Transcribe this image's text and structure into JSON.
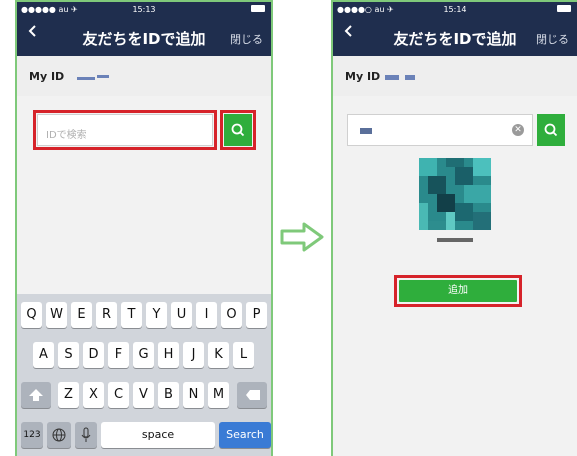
{
  "left": {
    "status": {
      "carrier": "●●●●● au ✈",
      "time": "15:13",
      "right": "✱"
    },
    "title": "友だちをIDで追加",
    "close": "閉じる",
    "myid_label": "My ID",
    "search": {
      "placeholder": "IDで検索"
    },
    "keyboard": {
      "row1": [
        "Q",
        "W",
        "E",
        "R",
        "T",
        "Y",
        "U",
        "I",
        "O",
        "P"
      ],
      "row2": [
        "A",
        "S",
        "D",
        "F",
        "G",
        "H",
        "J",
        "K",
        "L"
      ],
      "row3": [
        "Z",
        "X",
        "C",
        "V",
        "B",
        "N",
        "M"
      ],
      "row4": {
        "numbers": "123",
        "space": "space",
        "search": "Search"
      }
    }
  },
  "right": {
    "status": {
      "carrier": "●●●●○ au ✈",
      "time": "15:14",
      "right": "✱"
    },
    "title": "友だちをIDで追加",
    "close": "閉じる",
    "myid_label": "My ID",
    "add_button": "追加"
  },
  "colors": {
    "navbar": "#1f2e4e",
    "green": "#2fae3c",
    "highlight": "#d6232a",
    "frame": "#7fc97a"
  }
}
